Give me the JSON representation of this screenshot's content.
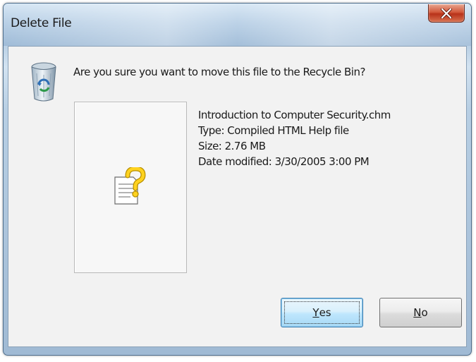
{
  "window": {
    "title": "Delete File",
    "close_icon": "close-x-icon"
  },
  "dialog": {
    "icon": "recycle-bin-icon",
    "question": "Are you sure you want to move this file to the Recycle Bin?",
    "preview_icon": "help-file-icon",
    "file": {
      "name": "Introduction to Computer Security.chm",
      "type": "Type: Compiled HTML Help file",
      "size": "Size: 2.76 MB",
      "date_modified": "Date modified: 3/30/2005 3:00 PM"
    }
  },
  "buttons": {
    "yes": {
      "mnemonic": "Y",
      "rest": "es"
    },
    "no": {
      "mnemonic": "N",
      "rest": "o"
    }
  },
  "colors": {
    "close_button": "#c8472b",
    "focus_button": "#bee6fd"
  }
}
